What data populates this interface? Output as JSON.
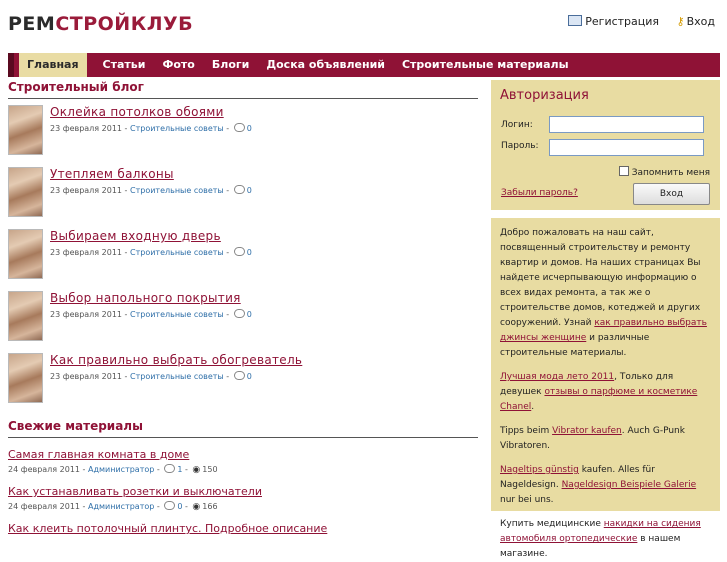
{
  "header": {
    "logo_part1": "РЕМ",
    "logo_part2": "СТРОЙ",
    "logo_part3": "КЛУБ",
    "register_label": "Регистрация",
    "login_label": "Вход"
  },
  "menu": {
    "items": [
      "Главная",
      "Статьи",
      "Фото",
      "Блоги",
      "Доска объявлений",
      "Строительные материалы"
    ]
  },
  "blog": {
    "title": "Строительный блог",
    "posts": [
      {
        "title": "Оклейка потолков обоями",
        "date": "23 февраля 2011",
        "category": "Строительные советы",
        "comments": "0"
      },
      {
        "title": "Утепляем балконы",
        "date": "23 февраля 2011",
        "category": "Строительные советы",
        "comments": "0"
      },
      {
        "title": "Выбираем входную дверь",
        "date": "23 февраля 2011",
        "category": "Строительные советы",
        "comments": "0"
      },
      {
        "title": "Выбор напольного покрытия",
        "date": "23 февраля 2011",
        "category": "Строительные советы",
        "comments": "0"
      },
      {
        "title": "Как правильно выбрать обогреватель",
        "date": "23 февраля 2011",
        "category": "Строительные советы",
        "comments": "0"
      }
    ]
  },
  "fresh": {
    "title": "Свежие материалы",
    "items": [
      {
        "title": "Самая главная комната в доме",
        "date": "24 февраля 2011",
        "author": "Администратор",
        "comments": "1",
        "views": "150"
      },
      {
        "title": "Как устанавливать розетки и выключатели",
        "date": "24 февраля 2011",
        "author": "Администратор",
        "comments": "0",
        "views": "166"
      },
      {
        "title": "Как клеить потолочный плинтус. Подробное описание",
        "date": "",
        "author": "",
        "comments": "",
        "views": ""
      }
    ]
  },
  "auth": {
    "title": "Авторизация",
    "login_label": "Логин:",
    "password_label": "Пароль:",
    "remember_label": "Запомнить меня",
    "forgot_label": "Забыли пароль?",
    "submit_label": "Вход"
  },
  "info": {
    "p1_text": "Добро пожаловать на наш сайт, посвященный строительству и ремонту квартир и домов. На наших страницах Вы найдете исчерпывающую информацию о всех видах ремонта, а так же о строительстве домов, котеджей и других сооружений. Узнай ",
    "p1_link": "как правильно выбрать джинсы женщине",
    "p1_tail": " и различные строительные материалы.",
    "p2_link1": "Лучшая мода лето 2011",
    "p2_text": ", Только для девушек ",
    "p2_link2": "отзывы о парфюме и косметике Chanel",
    "p2_tail": ".",
    "p3_text": "Tipps beim ",
    "p3_link": "Vibrator kaufen",
    "p3_tail": ". Auch G-Punk Vibratoren.",
    "p4_link1": "Nageltips günstig",
    "p4_text": " kaufen. Alles für Nageldesign. ",
    "p4_link2": "Nageldesign Beispiele Galerie",
    "p4_tail": " nur bei uns.",
    "p5_text": "Купить медицинские ",
    "p5_link": "накидки на сидения автомобиля ортопедические",
    "p5_tail": " в нашем магазине."
  },
  "colors": {
    "brand": "#8f1236",
    "panel": "#e8dca2",
    "link": "#2f6fa8"
  },
  "icons": {
    "register": "card-icon",
    "login": "key-icon",
    "comment": "comment-bubble-icon",
    "views": "eye-icon"
  }
}
